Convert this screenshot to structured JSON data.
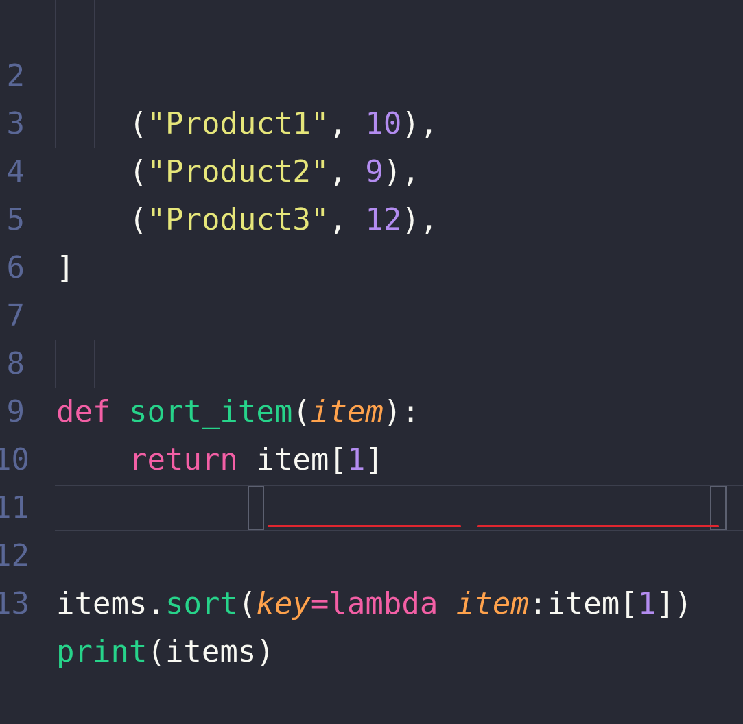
{
  "colors": {
    "background": "#272934",
    "string": "#e6e67a",
    "number": "#b38cf0",
    "keyword": "#f35fa5",
    "function": "#27d38a",
    "parameter": "#ffa24c",
    "error_underline": "#e0262f"
  },
  "lines": [
    {
      "number": "2",
      "indent": "    ",
      "open": "(",
      "string": "\"Product1\"",
      "comma": ", ",
      "value": "10",
      "close": "),"
    },
    {
      "number": "3",
      "indent": "    ",
      "open": "(",
      "string": "\"Product2\"",
      "comma": ", ",
      "value": "9",
      "close": "),"
    },
    {
      "number": "4",
      "indent": "    ",
      "open": "(",
      "string": "\"Product3\"",
      "comma": ", ",
      "value": "12",
      "close": "),"
    },
    {
      "number": "5",
      "text": "]"
    },
    {
      "number": "6"
    },
    {
      "number": "7"
    },
    {
      "number": "8",
      "kw": "def",
      "fname": "sort_item",
      "open": "(",
      "param": "item",
      "close": "):"
    },
    {
      "number": "9",
      "kw": "return",
      "rest_a": " item[",
      "value": "1",
      "rest_b": "]"
    },
    {
      "number": "10"
    },
    {
      "number": "11"
    },
    {
      "number": "12",
      "obj": "items.",
      "method": "sort",
      "open": "(",
      "kwarg": "key",
      "eq": "=",
      "lambda_kw": "lambda",
      "param": "item",
      "colon": ":",
      "body_a": "item[",
      "value": "1",
      "body_b": "]",
      "close": ")"
    },
    {
      "number": "13",
      "fname": "print",
      "args": "(items)"
    }
  ]
}
